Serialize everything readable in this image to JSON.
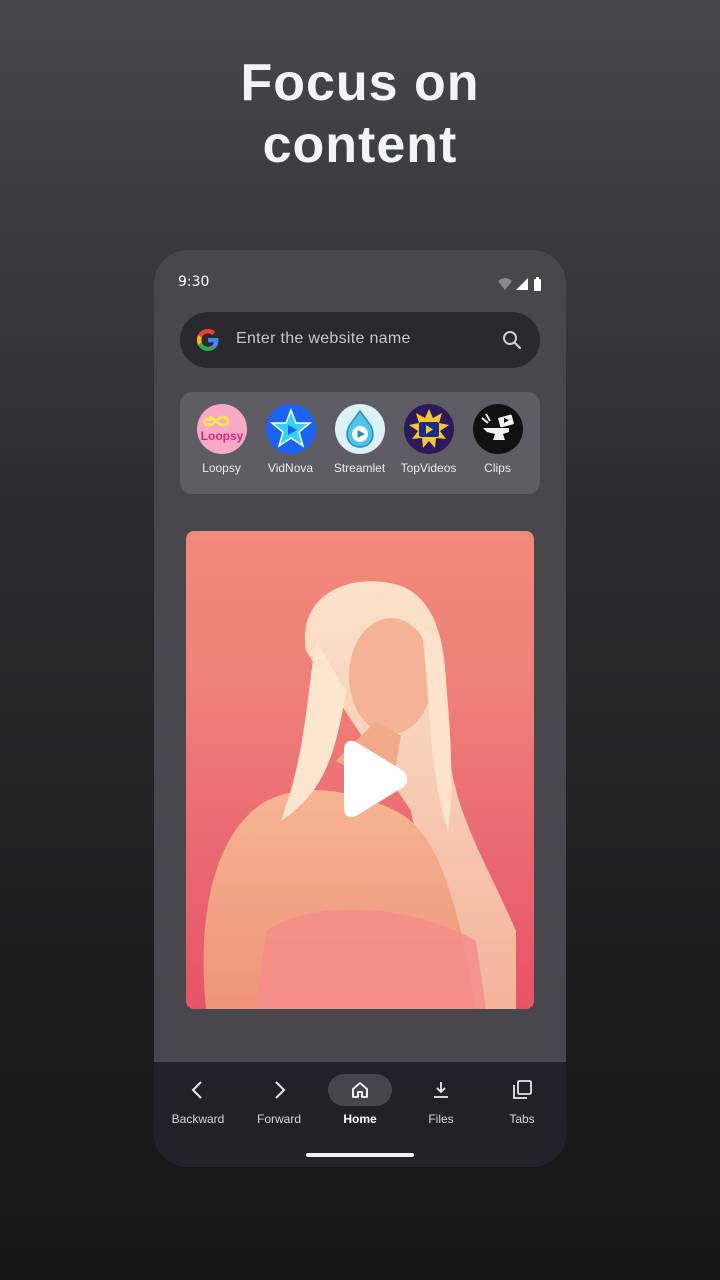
{
  "headline": {
    "line1": "Focus on",
    "line2": "content"
  },
  "status_bar": {
    "time": "9:30"
  },
  "search": {
    "placeholder": "Enter the website name"
  },
  "shortcuts": [
    {
      "label": "Loopsy",
      "icon": "loopsy-icon",
      "logo_text": "Loopsy"
    },
    {
      "label": "VidNova",
      "icon": "vidnova-star-icon"
    },
    {
      "label": "Streamlet",
      "icon": "streamlet-drop-icon"
    },
    {
      "label": "TopVideos",
      "icon": "topvideos-icon"
    },
    {
      "label": "Clips",
      "icon": "clips-icon"
    }
  ],
  "video": {
    "thumbnail": "portrait-thumbnail",
    "overlay_icon": "play-icon"
  },
  "nav": {
    "items": [
      {
        "label": "Backward",
        "icon": "chevron-left-icon"
      },
      {
        "label": "Forward",
        "icon": "chevron-right-icon"
      },
      {
        "label": "Home",
        "icon": "home-icon",
        "active": true
      },
      {
        "label": "Files",
        "icon": "download-icon"
      },
      {
        "label": "Tabs",
        "icon": "tabs-icon"
      }
    ]
  },
  "colors": {
    "accent_pink": "#ee7f77",
    "navbar_bg": "#22212a",
    "phone_bg": "#48474c"
  }
}
